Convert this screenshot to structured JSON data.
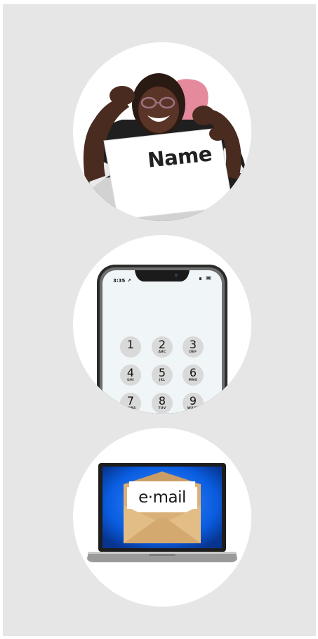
{
  "cards": [
    {
      "id": "name",
      "sign_text": "Name"
    },
    {
      "id": "phone",
      "status_time": "3:35 ↗",
      "keypad": [
        {
          "digit": "1",
          "letters": ""
        },
        {
          "digit": "2",
          "letters": "ABC"
        },
        {
          "digit": "3",
          "letters": "DEF"
        },
        {
          "digit": "4",
          "letters": "GHI"
        },
        {
          "digit": "5",
          "letters": "JKL"
        },
        {
          "digit": "6",
          "letters": "MNO"
        },
        {
          "digit": "7",
          "letters": "PQRS"
        },
        {
          "digit": "8",
          "letters": "TUV"
        },
        {
          "digit": "9",
          "letters": "WXYZ"
        }
      ]
    },
    {
      "id": "email",
      "label": "e·mail"
    }
  ],
  "colors": {
    "background": "#e6e6e6",
    "circle": "#ffffff",
    "laptop_screen": "#0a5de0",
    "envelope": "#d9b07a"
  },
  "icons": [
    "person-holding-sign-photo",
    "smartphone-keypad-icon",
    "laptop-email-icon"
  ]
}
